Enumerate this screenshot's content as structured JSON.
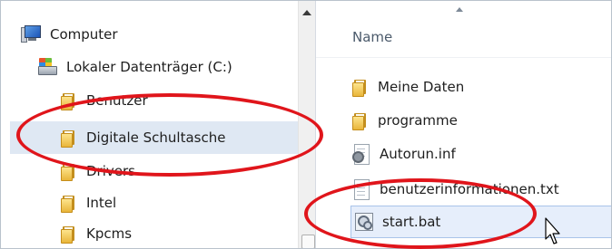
{
  "nav": {
    "items": [
      {
        "label": "Computer",
        "icon": "computer-icon"
      },
      {
        "label": "Lokaler Datenträger (C:)",
        "icon": "drive-icon"
      },
      {
        "label": "Benutzer",
        "icon": "folder-icon"
      },
      {
        "label": "Digitale Schultasche",
        "icon": "folder-icon",
        "selected": true
      },
      {
        "label": "Drivers",
        "icon": "folder-icon"
      },
      {
        "label": "Intel",
        "icon": "folder-icon"
      },
      {
        "label": "Kpcms",
        "icon": "folder-icon"
      }
    ]
  },
  "content": {
    "column_header": "Name",
    "files": [
      {
        "label": "Meine Daten",
        "icon": "folder-icon"
      },
      {
        "label": "programme",
        "icon": "folder-icon"
      },
      {
        "label": "Autorun.inf",
        "icon": "inf-file-icon"
      },
      {
        "label": "benutzerinformationen.txt",
        "icon": "text-file-icon"
      },
      {
        "label": "start.bat",
        "icon": "batch-file-icon",
        "selected": true
      }
    ]
  },
  "annotations": {
    "highlight_color": "#e0151b"
  },
  "colors": {
    "selection_background": "#dfe8f3",
    "folder_yellow": "#f2c94c"
  }
}
